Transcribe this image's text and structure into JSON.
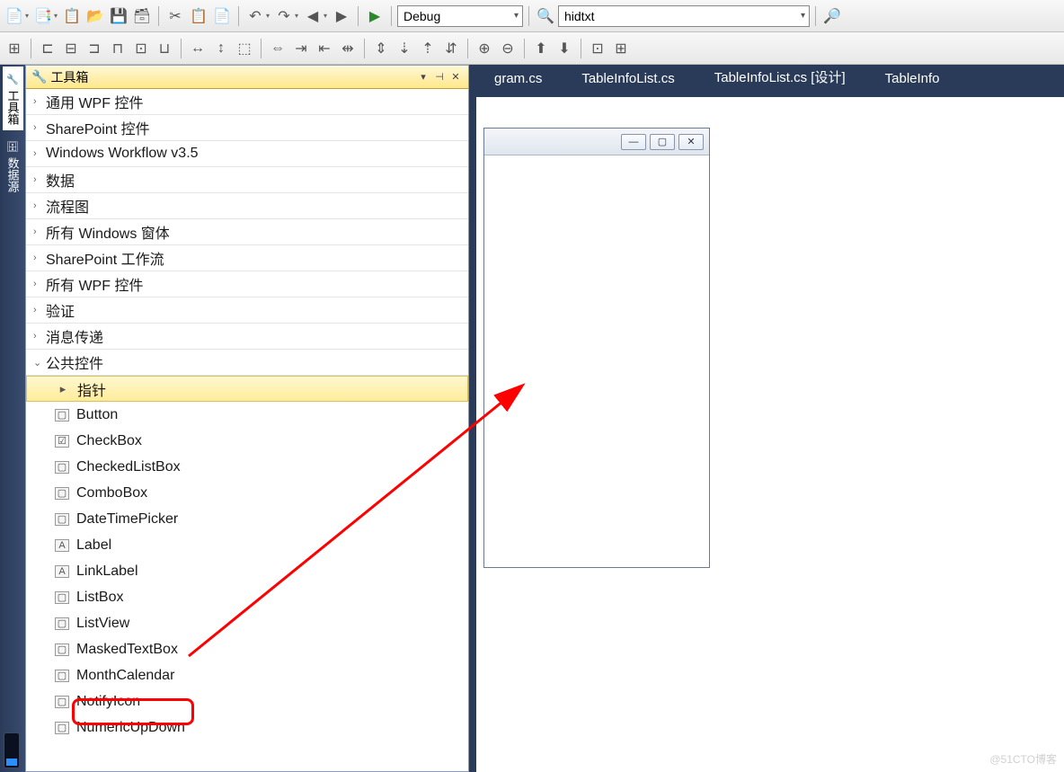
{
  "toolbar": {
    "config_combo": "Debug",
    "search_text": "hidtxt"
  },
  "side_tabs": {
    "toolbox": "工具箱",
    "datasource": "数据源"
  },
  "toolbox": {
    "title": "工具箱",
    "categories": [
      {
        "label": "通用 WPF 控件",
        "expanded": false
      },
      {
        "label": "SharePoint 控件",
        "expanded": false
      },
      {
        "label": "Windows Workflow v3.5",
        "expanded": false
      },
      {
        "label": "数据",
        "expanded": false
      },
      {
        "label": "流程图",
        "expanded": false
      },
      {
        "label": "所有 Windows 窗体",
        "expanded": false
      },
      {
        "label": "SharePoint 工作流",
        "expanded": false
      },
      {
        "label": "所有 WPF 控件",
        "expanded": false
      },
      {
        "label": "验证",
        "expanded": false
      },
      {
        "label": "消息传递",
        "expanded": false
      },
      {
        "label": "公共控件",
        "expanded": true
      }
    ],
    "items": [
      {
        "label": "指针",
        "icon": "pointer",
        "selected": true
      },
      {
        "label": "Button",
        "icon": "ab"
      },
      {
        "label": "CheckBox",
        "icon": "check"
      },
      {
        "label": "CheckedListBox",
        "icon": "clist"
      },
      {
        "label": "ComboBox",
        "icon": "combo"
      },
      {
        "label": "DateTimePicker",
        "icon": "date"
      },
      {
        "label": "Label",
        "icon": "A"
      },
      {
        "label": "LinkLabel",
        "icon": "A"
      },
      {
        "label": "ListBox",
        "icon": "list"
      },
      {
        "label": "ListView",
        "icon": "lview",
        "highlighted": true
      },
      {
        "label": "MaskedTextBox",
        "icon": "mask"
      },
      {
        "label": "MonthCalendar",
        "icon": "cal"
      },
      {
        "label": "NotifyIcon",
        "icon": "notify"
      },
      {
        "label": "NumericUpDown",
        "icon": "num"
      }
    ]
  },
  "doc_tabs": [
    "gram.cs",
    "TableInfoList.cs",
    "TableInfoList.cs [设计]",
    "TableInfo"
  ],
  "watermark": "@51CTO博客"
}
